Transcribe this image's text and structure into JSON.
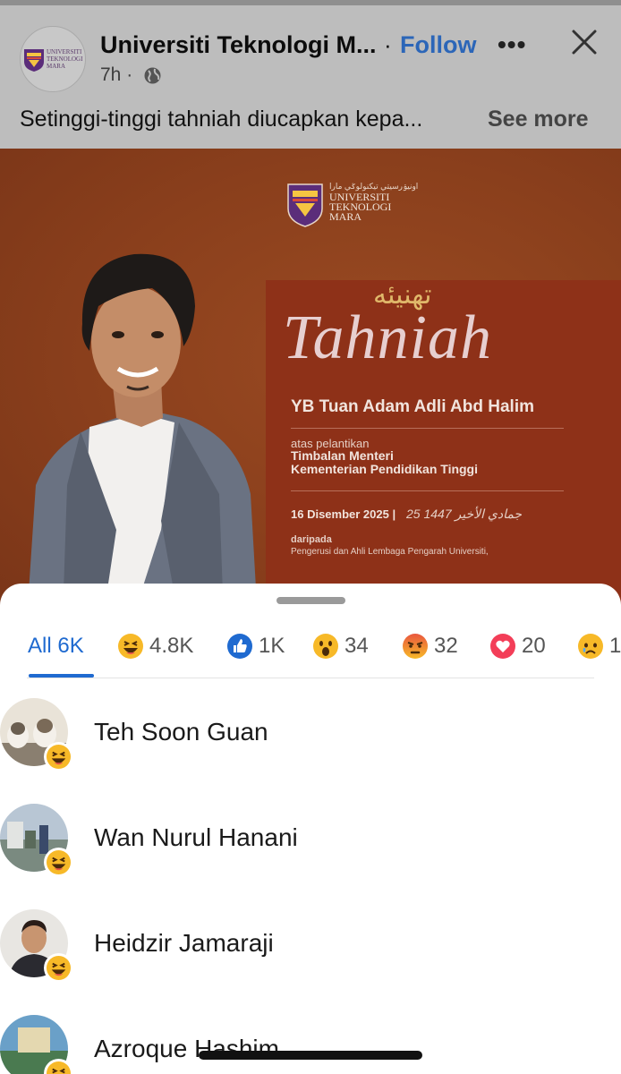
{
  "post": {
    "page_name": "Universiti Teknologi M...",
    "separator": "·",
    "follow_label": "Follow",
    "more_label": "•••",
    "time": "7h ·",
    "caption": "Setinggi-tinggi tahniah diucapkan kepa...",
    "see_more_label": "See more",
    "avatar_logo_text": "UNIVERSITI TEKNOLOGI MARA"
  },
  "image": {
    "logo_arabic": "اونيۏرسيتي تيكنولوݢي مارا",
    "logo_line1": "UNIVERSITI",
    "logo_line2": "TEKNOLOGI",
    "logo_line3": "MARA",
    "arabic_title": "تهنيئه",
    "title": "Tahniah",
    "name": "YB Tuan Adam Adli Abd Halim",
    "atas": "atas pelantikan",
    "position_line1": "Timbalan Menteri",
    "position_line2": "Kementerian Pendidikan Tinggi",
    "date": "16 Disember 2025  |",
    "date_hijri": "25 جمادي الأخير 1447",
    "from_label": "daripada",
    "from_text": "Pengerusi dan Ahli Lembaga Pengarah Universiti,"
  },
  "reactions": {
    "tabs": [
      {
        "label": "All 6K",
        "icon": "all"
      },
      {
        "label": "4.8K",
        "icon": "haha-icon"
      },
      {
        "label": "1K",
        "icon": "like-icon"
      },
      {
        "label": "34",
        "icon": "wow-icon"
      },
      {
        "label": "32",
        "icon": "angry-icon"
      },
      {
        "label": "20",
        "icon": "love-icon"
      },
      {
        "label": "1",
        "icon": "sad-icon"
      }
    ],
    "users": [
      {
        "name": "Teh Soon Guan",
        "reaction": "haha-icon"
      },
      {
        "name": "Wan Nurul Hanani",
        "reaction": "haha-icon"
      },
      {
        "name": "Heidzir Jamaraji",
        "reaction": "haha-icon"
      },
      {
        "name": "Azroque Hashim",
        "reaction": "haha-icon"
      }
    ]
  },
  "colors": {
    "accent": "#1f6ad0",
    "follow": "#2c66b8",
    "poster_bg": "#8a3f1c",
    "haha": "#f7b928"
  }
}
